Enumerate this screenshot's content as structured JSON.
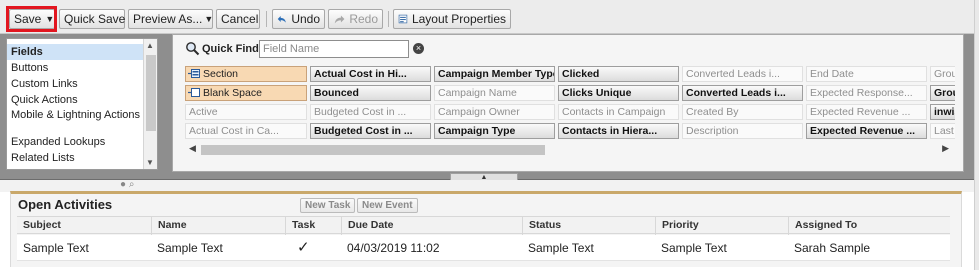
{
  "toolbar": {
    "save_label": "Save",
    "quick_save_label": "Quick Save",
    "preview_as_label": "Preview As...",
    "cancel_label": "Cancel",
    "undo_label": "Undo",
    "redo_label": "Redo",
    "layout_properties_label": "Layout Properties"
  },
  "palette": {
    "categories": [
      {
        "label": "Fields",
        "selected": true
      },
      {
        "label": "Buttons"
      },
      {
        "label": "Custom Links"
      },
      {
        "label": "Quick Actions"
      },
      {
        "label": "Mobile & Lightning Actions"
      },
      {
        "label": "Expanded Lookups"
      },
      {
        "label": "Related Lists"
      }
    ],
    "quick_find_label": "Quick Find",
    "quick_find_placeholder": "Field Name",
    "fields": [
      [
        "Section",
        "Actual Cost in Hi...",
        "Campaign Member Type",
        "Clicked",
        "Converted Leads i...",
        "End Date",
        "Grou"
      ],
      [
        "Blank Space",
        "Bounced",
        "Campaign Name",
        "Clicks Unique",
        "Converted Leads i...",
        "Expected Response...",
        "Grou"
      ],
      [
        "Active",
        "Budgeted Cost in ...",
        "Campaign Owner",
        "Contacts in Campaign",
        "Created By",
        "Expected Revenue ...",
        "inwis"
      ],
      [
        "Actual Cost in Ca...",
        "Budgeted Cost in ...",
        "Campaign Type",
        "Contacts in Hiera...",
        "Description",
        "Expected Revenue ...",
        "Last I"
      ]
    ]
  },
  "activities": {
    "title": "Open Activities",
    "new_task_label": "New Task",
    "new_event_label": "New Event",
    "columns": [
      "Subject",
      "Name",
      "Task",
      "Due Date",
      "Status",
      "Priority",
      "Assigned To"
    ],
    "row": {
      "subject": "Sample Text",
      "name": "Sample Text",
      "task": "✓",
      "due_date": "04/03/2019 11:02",
      "status": "Sample Text",
      "priority": "Sample Text",
      "assigned_to": "Sarah Sample"
    }
  },
  "colors": {
    "save_highlight": "#e2161f",
    "special_field": "#f8d9b3",
    "section_accent": "#c9a86a"
  }
}
